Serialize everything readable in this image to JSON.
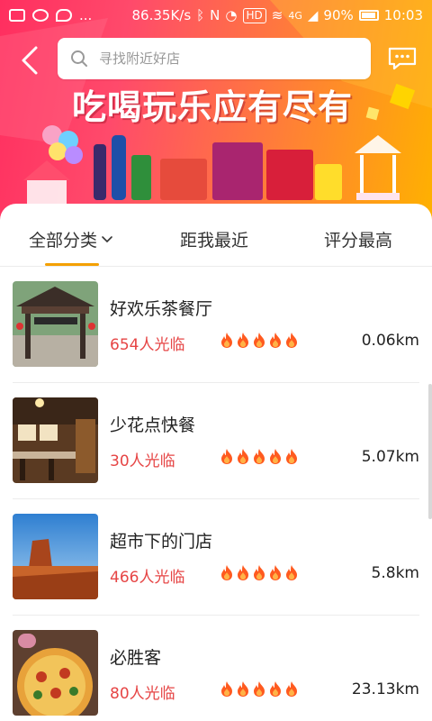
{
  "status_bar": {
    "net_speed": "86.35K/s",
    "hd": "HD",
    "signal": "4G",
    "battery": "90%",
    "time": "10:03",
    "dots": "..."
  },
  "header": {
    "search_placeholder": "寻找附近好店",
    "slogan": "吃喝玩乐应有尽有"
  },
  "tabs": [
    {
      "label": "全部分类",
      "active": true
    },
    {
      "label": "距我最近",
      "active": false
    },
    {
      "label": "评分最高",
      "active": false
    }
  ],
  "shops": [
    {
      "name": "好欢乐茶餐厅",
      "visits": "654人光临",
      "rating": 5,
      "distance": "0.06km"
    },
    {
      "name": "少花点快餐",
      "visits": "30人光临",
      "rating": 5,
      "distance": "5.07km"
    },
    {
      "name": "超市下的门店",
      "visits": "466人光临",
      "rating": 5,
      "distance": "5.8km"
    },
    {
      "name": "必胜客",
      "visits": "80人光临",
      "rating": 5,
      "distance": "23.13km"
    }
  ],
  "colors": {
    "accent": "#f4a000",
    "visits": "#e64545",
    "flame": "#ff5a1f"
  }
}
